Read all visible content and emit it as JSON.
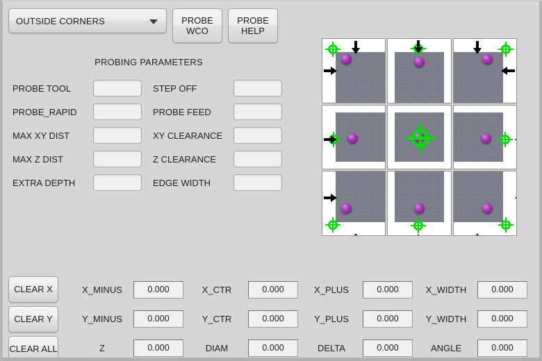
{
  "toolbar": {
    "mode_select": {
      "value": "OUTSIDE CORNERS",
      "arrow_icon": "chevron-down-icon"
    },
    "probe_wco_line1": "PROBE",
    "probe_wco_line2": "WCO",
    "probe_help_line1": "PROBE",
    "probe_help_line2": "HELP"
  },
  "parameters": {
    "title": "PROBING PARAMETERS",
    "rows": [
      {
        "left_label": "PROBE TOOL",
        "left_value": "",
        "right_label": "STEP OFF",
        "right_value": ""
      },
      {
        "left_label": "PROBE_RAPID",
        "left_value": "",
        "right_label": "PROBE FEED",
        "right_value": ""
      },
      {
        "left_label": "MAX XY DIST",
        "left_value": "",
        "right_label": "XY CLEARANCE",
        "right_value": ""
      },
      {
        "left_label": "MAX Z DIST",
        "left_value": "",
        "right_label": "Z CLEARANCE",
        "right_value": ""
      },
      {
        "left_label": "EXTRA DEPTH",
        "left_value": "",
        "right_label": "EDGE WIDTH",
        "right_value": ""
      }
    ]
  },
  "diagram": {
    "name": "probe-position-selector",
    "colors": {
      "stock": "#7a7f8a",
      "target": "#00e000",
      "probe_ball": "#8e2a9e",
      "arrow": "#000000"
    },
    "cells": [
      {
        "id": "top-left",
        "position": "top-left corner"
      },
      {
        "id": "top-center",
        "position": "top edge"
      },
      {
        "id": "top-right",
        "position": "top-right corner"
      },
      {
        "id": "middle-left",
        "position": "left edge"
      },
      {
        "id": "center",
        "position": "center"
      },
      {
        "id": "middle-right",
        "position": "right edge"
      },
      {
        "id": "bottom-left",
        "position": "bottom-left corner"
      },
      {
        "id": "bottom-center",
        "position": "bottom edge"
      },
      {
        "id": "bottom-right",
        "position": "bottom-right corner"
      }
    ]
  },
  "clear_buttons": [
    {
      "label": "CLEAR X"
    },
    {
      "label": "CLEAR Y"
    },
    {
      "label": "CLEAR ALL"
    }
  ],
  "readouts": {
    "rows": [
      [
        {
          "label": "X_MINUS",
          "value": "0.000"
        },
        {
          "label": "X_CTR",
          "value": "0.000"
        },
        {
          "label": "X_PLUS",
          "value": "0.000"
        },
        {
          "label": "X_WIDTH",
          "value": "0.000"
        }
      ],
      [
        {
          "label": "Y_MINUS",
          "value": "0.000"
        },
        {
          "label": "Y_CTR",
          "value": "0.000"
        },
        {
          "label": "Y_PLUS",
          "value": "0.000"
        },
        {
          "label": "Y_WIDTH",
          "value": "0.000"
        }
      ],
      [
        {
          "label": "Z",
          "value": "0.000"
        },
        {
          "label": "DIAM",
          "value": "0.000"
        },
        {
          "label": "DELTA",
          "value": "0.000"
        },
        {
          "label": "ANGLE",
          "value": "0.000"
        }
      ]
    ]
  }
}
